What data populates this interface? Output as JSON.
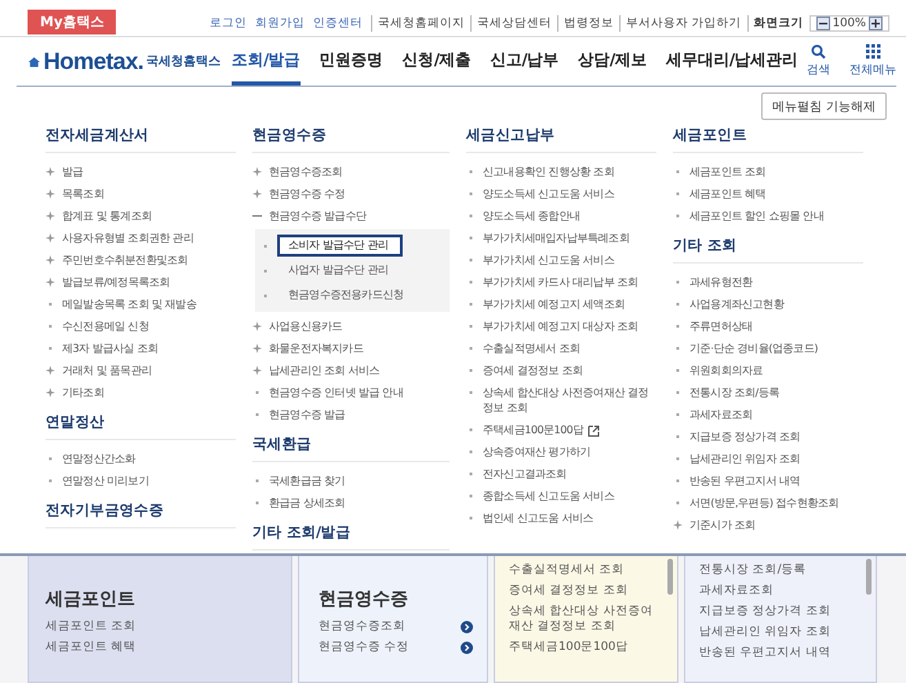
{
  "top_bar": {
    "my_tab": "My홈택스",
    "links": [
      {
        "label": "로그인",
        "kind": "account"
      },
      {
        "label": "회원가입",
        "kind": "account"
      },
      {
        "label": "인증센터",
        "kind": "account"
      },
      {
        "label": "국세청홈페이지",
        "kind": "site"
      },
      {
        "label": "국세상담센터",
        "kind": "site"
      },
      {
        "label": "법령정보",
        "kind": "site"
      },
      {
        "label": "부서사용자 가입하기",
        "kind": "site"
      }
    ],
    "zoom": {
      "label": "화면크기",
      "value": "100%"
    }
  },
  "header": {
    "logo": {
      "wordmark": "Hometax.",
      "name": "국세청홈택스"
    },
    "tabs": [
      {
        "label": "조회/발급",
        "selected": true
      },
      {
        "label": "민원증명",
        "selected": false
      },
      {
        "label": "신청/제출",
        "selected": false
      },
      {
        "label": "신고/납부",
        "selected": false
      },
      {
        "label": "상담/제보",
        "selected": false
      },
      {
        "label": "세무대리/납세관리",
        "selected": false
      }
    ],
    "tools": [
      {
        "label": "검색",
        "kind": "search"
      },
      {
        "label": "전체메뉴",
        "kind": "grid"
      }
    ]
  },
  "menu": {
    "toggle_button": "메뉴펼침 기능해제",
    "columns": [
      {
        "sections": [
          {
            "title": "전자세금계산서",
            "items": [
              {
                "label": "발급",
                "kind": "folder",
                "expanded": false
              },
              {
                "label": "목록조회",
                "kind": "folder",
                "expanded": false
              },
              {
                "label": "합계표 및 통계조회",
                "kind": "folder",
                "expanded": false
              },
              {
                "label": "사용자유형별 조회권한 관리",
                "kind": "folder",
                "expanded": false
              },
              {
                "label": "주민번호수취분전환및조회",
                "kind": "folder",
                "expanded": false
              },
              {
                "label": "발급보류/예정목록조회",
                "kind": "folder",
                "expanded": false
              },
              {
                "label": "메일발송목록 조회 및 재발송",
                "kind": "link"
              },
              {
                "label": "수신전용메일 신청",
                "kind": "link"
              },
              {
                "label": "제3자 발급사실 조회",
                "kind": "link"
              },
              {
                "label": "거래처 및 품목관리",
                "kind": "folder",
                "expanded": false
              },
              {
                "label": "기타조회",
                "kind": "folder",
                "expanded": false
              }
            ]
          },
          {
            "title": "연말정산",
            "items": [
              {
                "label": "연말정산간소화",
                "kind": "link"
              },
              {
                "label": "연말정산 미리보기",
                "kind": "link"
              }
            ]
          },
          {
            "title": "전자기부금영수증"
          }
        ]
      },
      {
        "sections": [
          {
            "title": "현금영수증",
            "items": [
              {
                "label": "현금영수증조회",
                "kind": "folder",
                "expanded": false
              },
              {
                "label": "현금영수증 수정",
                "kind": "folder",
                "expanded": false
              },
              {
                "label": "현금영수증 발급수단",
                "kind": "folder",
                "expanded": true,
                "children": [
                  {
                    "label": "소비자 발급수단 관리",
                    "selected": true
                  },
                  {
                    "label": "사업자 발급수단 관리",
                    "selected": false
                  },
                  {
                    "label": "현금영수증전용카드신청",
                    "selected": false
                  }
                ]
              },
              {
                "label": "사업용신용카드",
                "kind": "folder",
                "expanded": false
              },
              {
                "label": "화물운전자복지카드",
                "kind": "folder",
                "expanded": false
              },
              {
                "label": "납세관리인 조회 서비스",
                "kind": "folder",
                "expanded": false
              },
              {
                "label": "현금영수증 인터넷 발급 안내",
                "kind": "link"
              },
              {
                "label": "현금영수증 발급",
                "kind": "link"
              }
            ]
          },
          {
            "title": "국세환급",
            "items": [
              {
                "label": "국세환급금 찾기",
                "kind": "link"
              },
              {
                "label": "환급금 상세조회",
                "kind": "link"
              }
            ]
          },
          {
            "title": "기타 조회/발급"
          }
        ]
      },
      {
        "sections": [
          {
            "title": "세금신고납부",
            "items": [
              {
                "label": "신고내용확인 진행상황 조회",
                "kind": "link"
              },
              {
                "label": "양도소득세 신고도움 서비스",
                "kind": "link"
              },
              {
                "label": "양도소득세 종합안내",
                "kind": "link"
              },
              {
                "label": "부가가치세매입자납부특례조회",
                "kind": "link"
              },
              {
                "label": "부가가치세 신고도움 서비스",
                "kind": "link"
              },
              {
                "label": "부가가치세 카드사 대리납부 조회",
                "kind": "link"
              },
              {
                "label": "부가가치세 예정고지 세액조회",
                "kind": "link"
              },
              {
                "label": "부가가치세 예정고지 대상자 조회",
                "kind": "link"
              },
              {
                "label": "수출실적명세서 조회",
                "kind": "link"
              },
              {
                "label": "증여세 결정정보 조회",
                "kind": "link"
              },
              {
                "label": "상속세 합산대상 사전증여재산 결정정보 조회",
                "kind": "link"
              },
              {
                "label": "주택세금100문100답",
                "kind": "external"
              },
              {
                "label": "상속증여재산 평가하기",
                "kind": "link"
              },
              {
                "label": "전자신고결과조회",
                "kind": "link"
              },
              {
                "label": "종합소득세 신고도움 서비스",
                "kind": "link"
              },
              {
                "label": "법인세 신고도움 서비스",
                "kind": "link"
              }
            ]
          }
        ]
      },
      {
        "sections": [
          {
            "title": "세금포인트",
            "items": [
              {
                "label": "세금포인트 조회",
                "kind": "link"
              },
              {
                "label": "세금포인트 혜택",
                "kind": "link"
              },
              {
                "label": "세금포인트 할인 쇼핑몰 안내",
                "kind": "link"
              }
            ]
          },
          {
            "title": "기타 조회",
            "items": [
              {
                "label": "과세유형전환",
                "kind": "link"
              },
              {
                "label": "사업용계좌신고현황",
                "kind": "link"
              },
              {
                "label": "주류면허상태",
                "kind": "link"
              },
              {
                "label": "기준·단순 경비율(업종코드)",
                "kind": "link"
              },
              {
                "label": "위원회회의자료",
                "kind": "link"
              },
              {
                "label": "전통시장 조회/등록",
                "kind": "link"
              },
              {
                "label": "과세자료조회",
                "kind": "link"
              },
              {
                "label": "지급보증 정상가격 조회",
                "kind": "link"
              },
              {
                "label": "납세관리인 위임자 조회",
                "kind": "link"
              },
              {
                "label": "반송된 우편고지서 내역",
                "kind": "link"
              },
              {
                "label": "서면(방문,우편등) 접수현황조회",
                "kind": "link"
              },
              {
                "label": "기준시가 조회",
                "kind": "folder",
                "expanded": false
              }
            ]
          }
        ]
      }
    ]
  },
  "background_cards": [
    {
      "title": "세금포인트",
      "kind": "lavender",
      "items": [
        "세금포인트 조회",
        "세금포인트 혜택"
      ]
    },
    {
      "title": "현금영수증",
      "kind": "blue-arrow",
      "items": [
        "현금영수증조회",
        "현금영수증 수정"
      ]
    },
    {
      "kind": "yellow-scroll",
      "items": [
        "수출실적명세서 조회",
        "증여세 결정정보 조회",
        "상속세 합산대상 사전증여재산 결정정보 조회",
        "주택세금100문100답"
      ]
    },
    {
      "kind": "blue-scroll",
      "items": [
        "전통시장 조회/등록",
        "과세자료조회",
        "지급보증 정상가격 조회",
        "납세관리인 위임자 조회",
        "반송된 우편고지서 내역"
      ]
    }
  ]
}
